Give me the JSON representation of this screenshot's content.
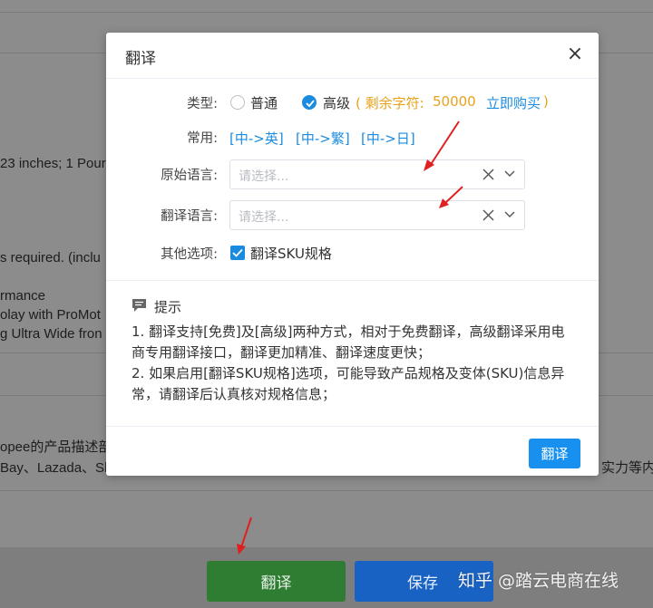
{
  "background": {
    "lines": [
      "23 inches; 1 Pour",
      "s required. (inclu",
      "rmance",
      "olay with ProMot",
      "g Ultra Wide fron",
      "opee的产品描述部",
      "Bay、Lazada、Sh",
      "实力等内"
    ]
  },
  "modal": {
    "title": "翻译",
    "close_label": "×",
    "type_label": "类型:",
    "type_options": [
      {
        "label": "普通",
        "checked": false
      },
      {
        "label": "高级",
        "checked": true
      }
    ],
    "remaining_open": "( 剩余字符:",
    "remaining_count": "50000",
    "buy_link": "立即购买",
    "remaining_close": ")",
    "common_label": "常用:",
    "quick_links": [
      "[中->英]",
      "[中->繁]",
      "[中->日]"
    ],
    "source_lang_label": "原始语言:",
    "source_lang_placeholder": "请选择...",
    "target_lang_label": "翻译语言:",
    "target_lang_placeholder": "请选择...",
    "other_label": "其他选项:",
    "sku_option_label": "翻译SKU规格",
    "sku_option_checked": true,
    "tips_title": "提示",
    "tips": [
      "1. 翻译支持[免费]及[高级]两种方式，相对于免费翻译，高级翻译采用电",
      "商专用翻译接口，翻译更加精准、翻译速度更快；",
      "2. 如果启用[翻译SKU规格]选项，可能导致产品规格及变体(SKU)信息异",
      "常，请翻译后认真核对规格信息；"
    ],
    "translate_button": "翻译"
  },
  "bottom_bar": {
    "translate_button": "翻译",
    "save_button": "保存"
  },
  "watermark": "知乎 @踏云电商在线",
  "colors": {
    "primary": "#1890f0",
    "accent_orange": "#e8a21b",
    "green_button": "#2e7d32",
    "blue_button": "#1862c4",
    "annotation_arrow": "#e02020"
  }
}
